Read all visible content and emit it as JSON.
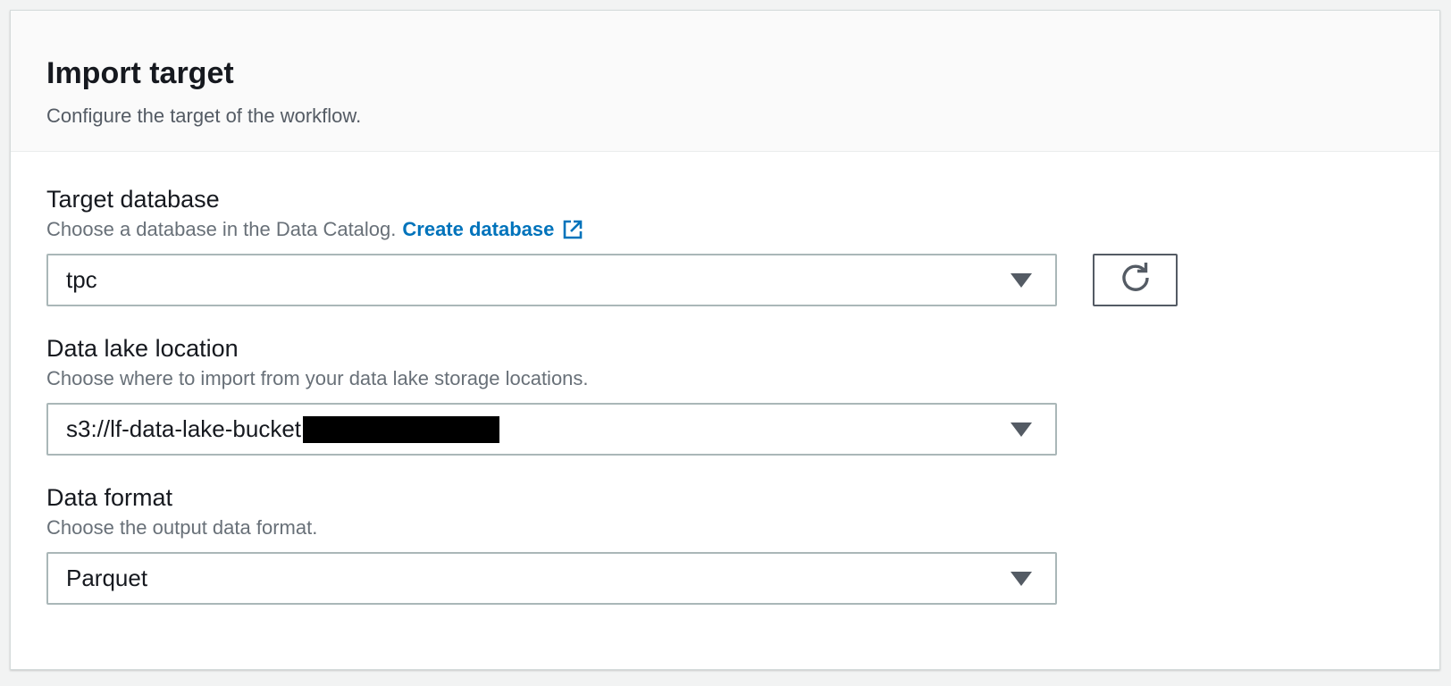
{
  "header": {
    "title": "Import target",
    "description": "Configure the target of the workflow."
  },
  "fields": {
    "target_database": {
      "label": "Target database",
      "description": "Choose a database in the Data Catalog.",
      "link_label": "Create database",
      "value": "tpc"
    },
    "data_lake_location": {
      "label": "Data lake location",
      "description": "Choose where to import from your data lake storage locations.",
      "value": "s3://lf-data-lake-bucket"
    },
    "data_format": {
      "label": "Data format",
      "description": "Choose the output data format.",
      "value": "Parquet"
    }
  },
  "icons": {
    "refresh": "refresh-icon",
    "external_link": "external-link-icon",
    "dropdown": "caret-down-icon"
  },
  "colors": {
    "link": "#0073bb",
    "text": "#16191f",
    "muted": "#687078",
    "border": "#aab7b8"
  }
}
